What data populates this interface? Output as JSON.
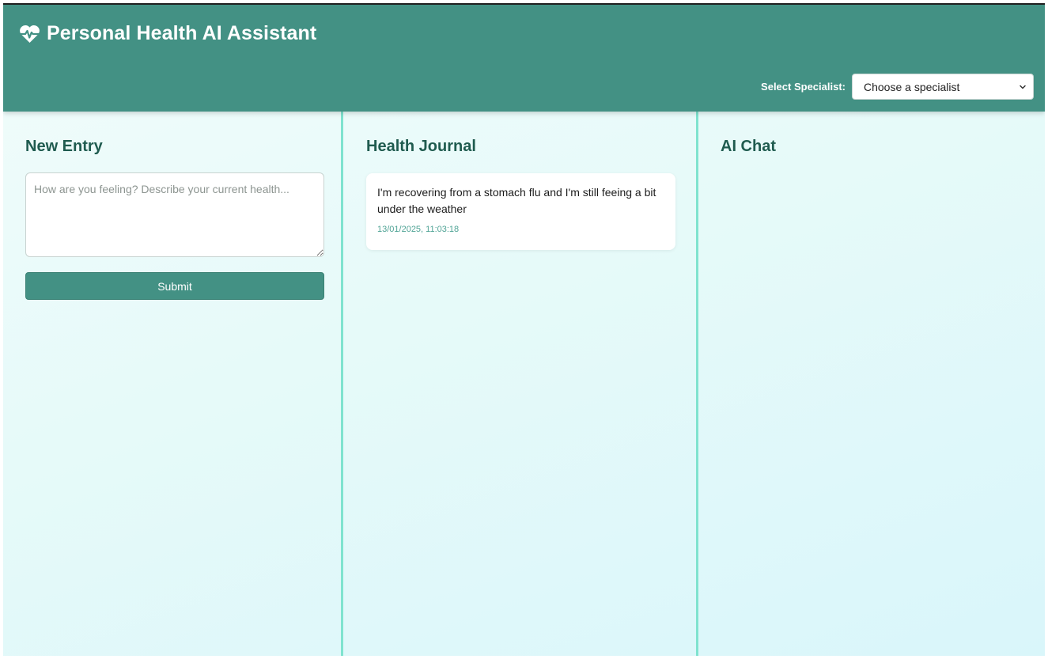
{
  "header": {
    "title": "Personal Health AI Assistant",
    "logo_icon": "heart-pulse-icon",
    "specialist_label": "Select Specialist:",
    "specialist_selected": "Choose a specialist"
  },
  "new_entry": {
    "heading": "New Entry",
    "textarea_placeholder": "How are you feeling? Describe your current health...",
    "textarea_value": "",
    "submit_label": "Submit"
  },
  "journal": {
    "heading": "Health Journal",
    "entries": [
      {
        "text": "I'm recovering from a stomach flu and I'm still feeing a bit under the weather",
        "timestamp": "13/01/2025, 11:03:18"
      }
    ]
  },
  "chat": {
    "heading": "AI Chat"
  },
  "colors": {
    "header_bg": "#439184",
    "accent": "#439184",
    "divider": "#7fe3cf",
    "heading_text": "#1f5b4f",
    "timestamp_text": "#4fa395"
  }
}
